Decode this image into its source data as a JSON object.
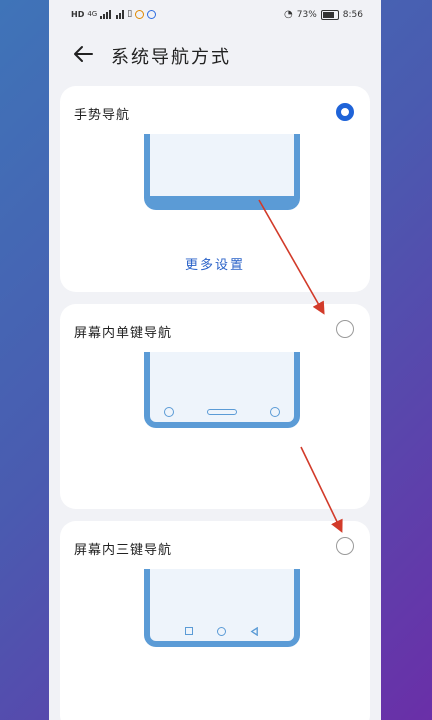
{
  "status_bar": {
    "left_labels": [
      "HD",
      "4G"
    ],
    "battery": "73%",
    "time": "8:56"
  },
  "header": {
    "back_icon": "arrow-left-icon",
    "title": "系统导航方式"
  },
  "options": [
    {
      "label": "手势导航",
      "selected": true,
      "link": "更多设置"
    },
    {
      "label": "屏幕内单键导航",
      "selected": false
    },
    {
      "label": "屏幕内三键导航",
      "selected": false
    }
  ],
  "colors": {
    "accent": "#1f63d8",
    "device_frame": "#5b9bd6",
    "annotation_arrow": "#d23b2a"
  }
}
